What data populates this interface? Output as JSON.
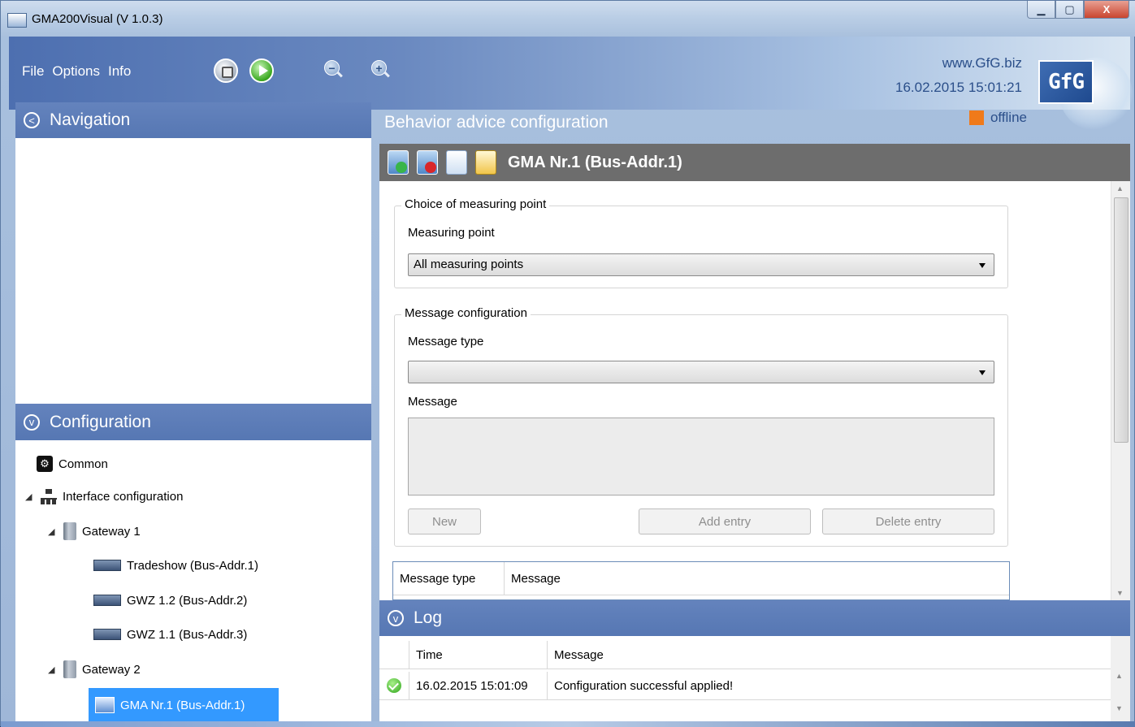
{
  "window": {
    "title": "GMA200Visual (V 1.0.3)",
    "min_label": "▁",
    "max_label": "▢",
    "close_label": "X"
  },
  "menu": {
    "file": "File",
    "options": "Options",
    "info": "Info"
  },
  "header": {
    "website": "www.GfG.biz",
    "datetime": "16.02.2015 15:01:21",
    "status": "offline",
    "status_color": "#f07a1a",
    "logo_text": "GfG"
  },
  "navigation": {
    "title": "Navigation",
    "collapse_glyph": "<"
  },
  "page": {
    "title": "Behavior advice configuration"
  },
  "configuration": {
    "title": "Configuration",
    "expand_glyph": "v",
    "tree": {
      "common": "Common",
      "interface": "Interface configuration",
      "gateway1": "Gateway 1",
      "g1_devices": [
        "Tradeshow (Bus-Addr.1)",
        "GWZ 1.2 (Bus-Addr.2)",
        "GWZ 1.1 (Bus-Addr.3)"
      ],
      "gateway2": "Gateway 2",
      "g2_device": "GMA Nr.1 (Bus-Addr.1)"
    }
  },
  "main": {
    "device_title": "GMA Nr.1 (Bus-Addr.1)",
    "measuring": {
      "legend": "Choice of measuring point",
      "label": "Measuring point",
      "selected": "All measuring points"
    },
    "message": {
      "legend": "Message configuration",
      "type_label": "Message type",
      "type_selected": "",
      "message_label": "Message",
      "buttons": {
        "new": "New",
        "add": "Add entry",
        "delete": "Delete entry"
      }
    },
    "table": {
      "columns": [
        "Message type",
        "Message"
      ]
    }
  },
  "log": {
    "title": "Log",
    "columns": [
      "Time",
      "Message"
    ],
    "rows": [
      {
        "time": "16.02.2015 15:01:09",
        "message": "Configuration successful applied!"
      }
    ]
  }
}
